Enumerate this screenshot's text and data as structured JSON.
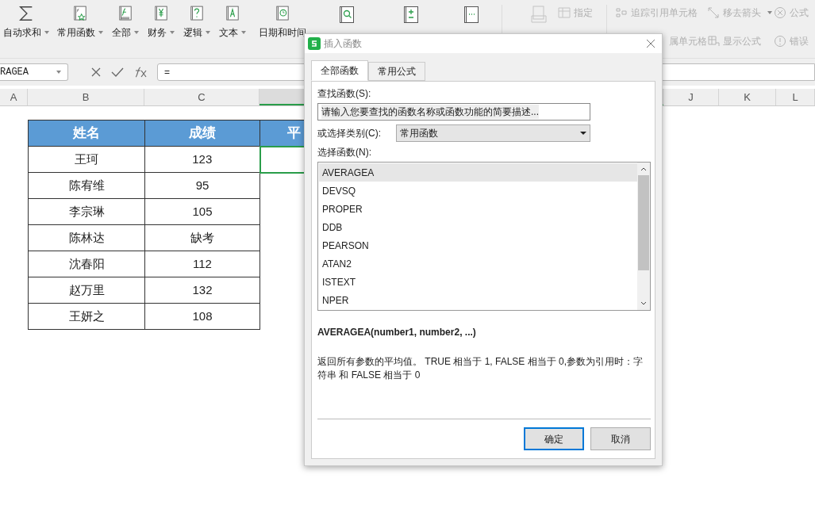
{
  "ribbon": {
    "function_buttons": [
      {
        "label": "自动求和",
        "dropdown": true
      },
      {
        "label": "常用函数",
        "dropdown": true
      },
      {
        "label": "全部",
        "dropdown": true
      },
      {
        "label": "财务",
        "dropdown": true
      },
      {
        "label": "逻辑",
        "dropdown": true
      },
      {
        "label": "文本",
        "dropdown": true
      },
      {
        "label": "日期和时间",
        "dropdown": false
      },
      {
        "dropdown": false
      },
      {
        "dropdown": false
      },
      {
        "dropdown": false
      }
    ],
    "name_tools": [
      {
        "label": "指定",
        "disabled": true
      }
    ],
    "audit_tools": [
      {
        "label": "追踪引用单元格",
        "disabled": true,
        "dropdown": false
      },
      {
        "label": "移去箭头",
        "disabled": true,
        "dropdown": true
      },
      {
        "label": "公式",
        "disabled": true,
        "dropdown": false
      },
      {
        "label": "属单元格",
        "disabled": true,
        "dropdown": false
      },
      {
        "label": "显示公式",
        "disabled": true,
        "dropdown": false
      },
      {
        "label": "错误",
        "disabled": true,
        "dropdown": false
      }
    ]
  },
  "formula_bar": {
    "name_box": "RAGEA",
    "formula": "="
  },
  "column_headers": [
    {
      "label": "A",
      "selected": false
    },
    {
      "label": "B",
      "selected": false
    },
    {
      "label": "C",
      "selected": false
    },
    {
      "selected": true
    },
    {
      "label": "J",
      "selected": false
    },
    {
      "label": "K",
      "selected": false
    },
    {
      "label": "L",
      "selected": false
    }
  ],
  "table": {
    "columns": [
      "姓名",
      "成绩",
      "平"
    ],
    "rows": [
      [
        "王珂",
        "123"
      ],
      [
        "陈宥维",
        "95"
      ],
      [
        "李宗琳",
        "105"
      ],
      [
        "陈林达",
        "缺考"
      ],
      [
        "沈春阳",
        "112"
      ],
      [
        "赵万里",
        "132"
      ],
      [
        "王妍之",
        "108"
      ]
    ]
  },
  "dialog": {
    "title": "插入函数",
    "tabs": [
      {
        "label": "全部函数",
        "selected": true
      },
      {
        "label": "常用公式",
        "selected": false
      }
    ],
    "search_label": "查找函数(S):",
    "search_value": "请输入您要查找的函数名称或函数功能的简要描述...",
    "category_label": "或选择类别(C):",
    "category_value": "常用函数",
    "list_label": "选择函数(N):",
    "functions": [
      {
        "name": "AVERAGEA",
        "selected": true
      },
      {
        "name": "DEVSQ",
        "selected": false
      },
      {
        "name": "PROPER",
        "selected": false
      },
      {
        "name": "DDB",
        "selected": false
      },
      {
        "name": "PEARSON",
        "selected": false
      },
      {
        "name": "ATAN2",
        "selected": false
      },
      {
        "name": "ISTEXT",
        "selected": false
      },
      {
        "name": "NPER",
        "selected": false
      }
    ],
    "signature": "AVERAGEA(number1, number2, ...)",
    "description": "返回所有参数的平均值。 TRUE 相当于 1, FALSE 相当于 0,参数为引用时：字符串 和 FALSE 相当于 0",
    "buttons": [
      {
        "label": "确定",
        "default": true
      },
      {
        "label": "取消",
        "default": false
      }
    ]
  }
}
